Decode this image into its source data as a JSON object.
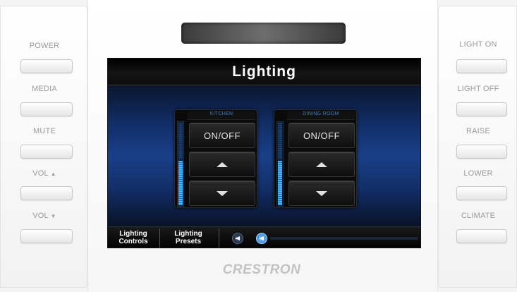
{
  "left_buttons": [
    {
      "label": "POWER"
    },
    {
      "label": "MEDIA"
    },
    {
      "label": "MUTE"
    },
    {
      "label": "VOL",
      "arrow": "▲"
    },
    {
      "label": "VOL",
      "arrow": "▼"
    }
  ],
  "right_buttons": [
    {
      "label": "LIGHT ON"
    },
    {
      "label": "LIGHT OFF"
    },
    {
      "label": "RAISE"
    },
    {
      "label": "LOWER"
    },
    {
      "label": "CLIMATE"
    }
  ],
  "screen": {
    "title": "Lighting",
    "zones": [
      {
        "name": "KITCHEN",
        "on_off_label": "ON/OFF",
        "level_fraction": 0.55
      },
      {
        "name": "DINING ROOM",
        "on_off_label": "ON/OFF",
        "level_fraction": 0.55
      }
    ],
    "footer": {
      "tab1_line1": "Lighting",
      "tab1_line2": "Controls",
      "tab2_line1": "Lighting",
      "tab2_line2": "Presets",
      "volume_fraction": 0.0
    }
  },
  "brand": "CRESTRON",
  "colors": {
    "accent_blue": "#1a78d6",
    "zone_title_blue": "#3f7fcc",
    "meter_blue": "#3fb6ff"
  },
  "icons": {
    "mute": "speaker-mute-icon",
    "volume": "speaker-volume-icon",
    "raise": "triangle-up-icon",
    "lower": "triangle-down-icon"
  }
}
